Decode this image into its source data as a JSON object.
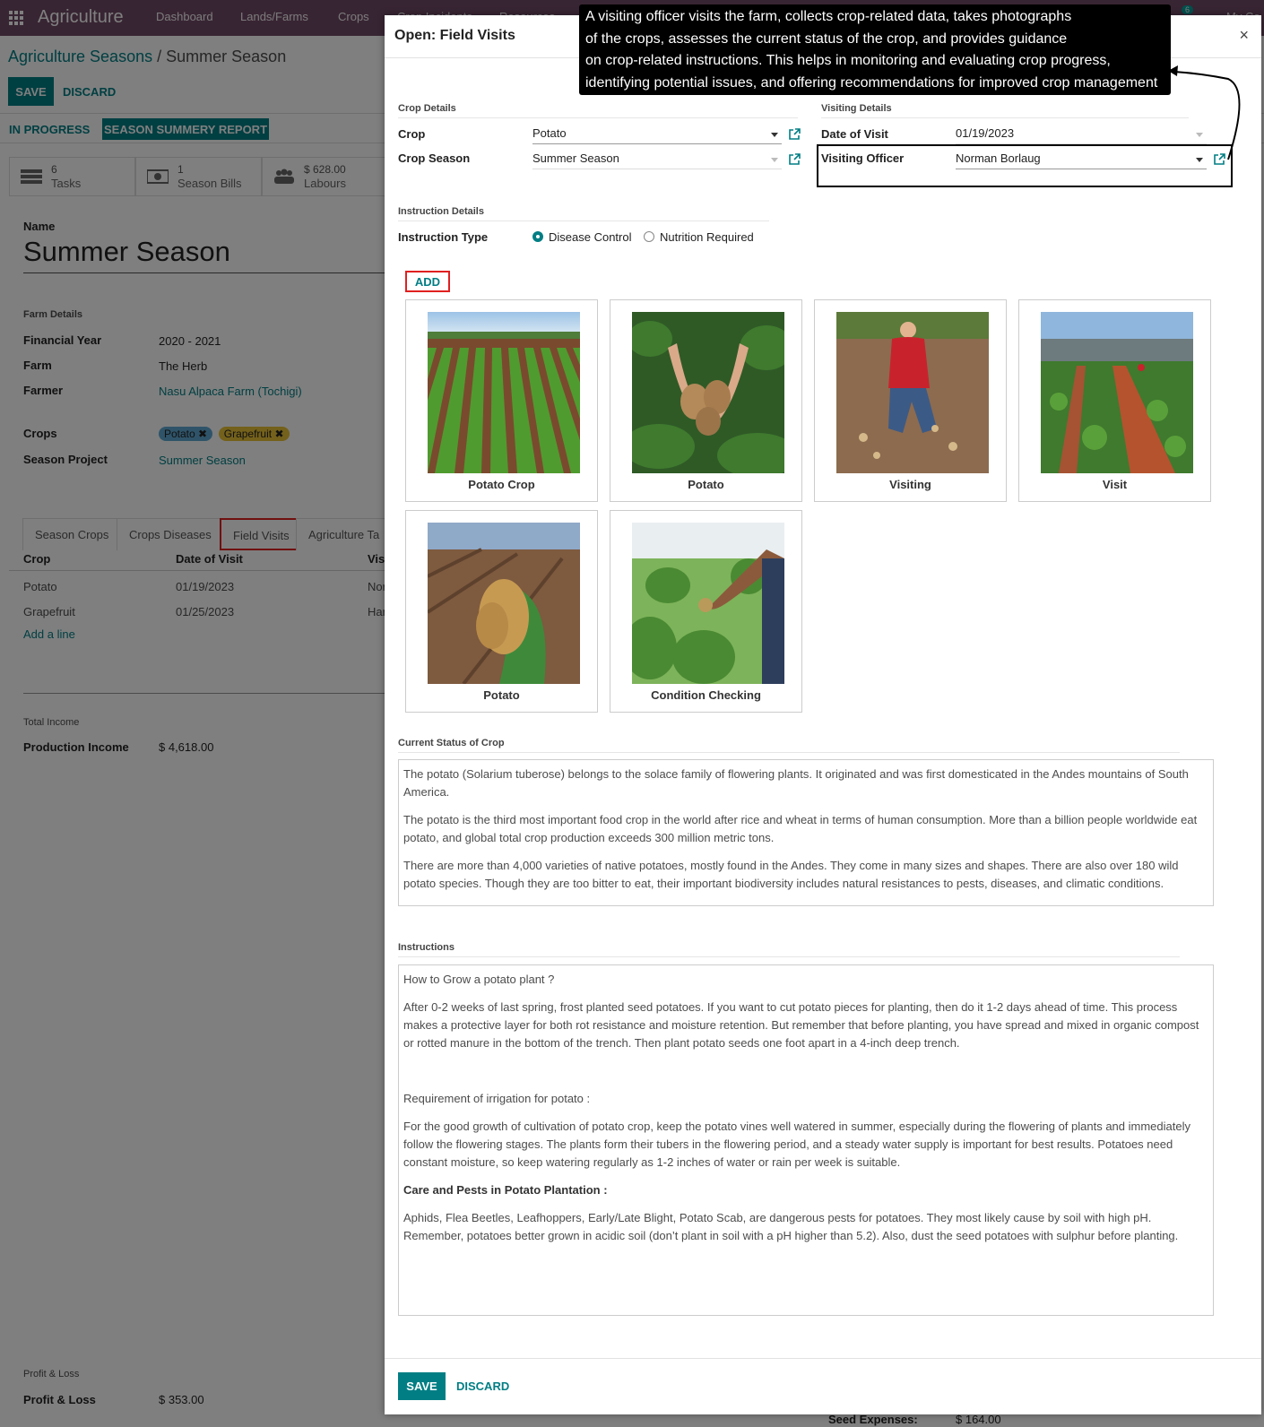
{
  "navbar": {
    "brand": "Agriculture",
    "menus": [
      "Dashboard",
      "Lands/Farms",
      "Crops",
      "Crop Incidents",
      "Resources"
    ],
    "badge": "6",
    "user": "My Co"
  },
  "breadcrumb": {
    "parent": "Agriculture Seasons",
    "separator": "/",
    "current": "Summer Season"
  },
  "form_buttons": {
    "save": "SAVE",
    "discard": "DISCARD"
  },
  "status_buttons": {
    "in_progress": "IN PROGRESS",
    "report": "SEASON SUMMERY REPORT"
  },
  "stats": [
    {
      "num": "6",
      "label": "Tasks",
      "icon": "tasks-icon"
    },
    {
      "num": "1",
      "label": "Season Bills",
      "icon": "bill-icon"
    },
    {
      "num": "$ 628.00",
      "label": "Labours",
      "icon": "users-icon"
    }
  ],
  "season": {
    "name_label": "Name",
    "name": "Summer Season",
    "farm_details_title": "Farm Details",
    "financial_year_label": "Financial Year",
    "financial_year": "2020 - 2021",
    "farm_label": "Farm",
    "farm": "The Herb",
    "farmer_label": "Farmer",
    "farmer": "Nasu Alpaca Farm (Tochigi)",
    "crops_label": "Crops",
    "crops": [
      {
        "name": "Potato",
        "color": "#5fa8d3"
      },
      {
        "name": "Grapefruit",
        "color": "#e8c336"
      }
    ],
    "project_label": "Season Project",
    "project": "Summer Season"
  },
  "season_tabs": [
    "Season Crops",
    "Crops Diseases",
    "Field Visits",
    "Agriculture Ta"
  ],
  "visits_table": {
    "headers": [
      "Crop",
      "Date of Visit",
      "Vis"
    ],
    "rows": [
      [
        "Potato",
        "01/19/2023",
        "Nor"
      ],
      [
        "Grapefruit",
        "01/25/2023",
        "Har"
      ]
    ],
    "add_line": "Add a line"
  },
  "income": {
    "title": "Total Income",
    "label": "Production Income",
    "value": "$ 4,618.00"
  },
  "profit": {
    "title": "Profit & Loss",
    "label": "Profit & Loss",
    "value": "$ 353.00"
  },
  "seed_expenses": {
    "label": "Seed Expenses:",
    "value": "$ 164.00"
  },
  "modal": {
    "title": "Open: Field Visits",
    "close": "×",
    "crop_details_title": "Crop Details",
    "crop_label": "Crop",
    "crop": "Potato",
    "season_label": "Crop Season",
    "season": "Summer Season",
    "visiting_details_title": "Visiting Details",
    "date_label": "Date of Visit",
    "date": "01/19/2023",
    "officer_label": "Visiting Officer",
    "officer": "Norman Borlaug",
    "instruction_details_title": "Instruction Details",
    "instruction_type_label": "Instruction Type",
    "instruction_options": [
      "Disease Control",
      "Nutrition Required"
    ],
    "instruction_selected": "Disease Control",
    "add_button": "ADD",
    "images": [
      "Potato Crop",
      "Potato",
      "Visiting",
      "Visit",
      "Potato",
      "Condition Checking"
    ],
    "status_title": "Current Status of Crop",
    "status_paragraphs": [
      "The potato (Solarium tuberose) belongs to the solace family of flowering plants. It originated and was first domesticated in the Andes mountains of South America.",
      "The potato is the third most important food crop in the world after rice and wheat in terms of human consumption. More than a billion people worldwide eat potato, and global total crop production exceeds 300 million metric tons.",
      "There are more than 4,000 varieties of native potatoes, mostly found in the Andes. They come in many sizes and shapes. There are also over 180 wild potato species. Though they are too bitter to eat, their important biodiversity includes natural resistances to pests, diseases, and climatic conditions."
    ],
    "instructions_title": "Instructions",
    "instructions": {
      "p1": "How to Grow a potato plant ?",
      "p2": "After 0-2 weeks of last spring, frost planted seed potatoes. If you want to cut potato pieces for planting, then do it 1-2 days ahead of time. This process makes a protective layer for both rot resistance and moisture retention. But remember that before planting, you have spread and mixed in organic compost or rotted manure in the bottom of the trench. Then plant potato seeds one foot apart in a 4-inch deep trench.",
      "p3": "Requirement of irrigation for potato :",
      "p4": "For the good growth of cultivation of potato crop, keep the potato vines well watered in summer, especially during the flowering of plants and immediately follow the flowering stages. The plants form their tubers in the flowering period, and a steady water supply is important for best results. Potatoes need constant moisture, so keep watering regularly as 1-2 inches of water or rain per week is suitable.",
      "p5": "Care and Pests in Potato Plantation :",
      "p6": "Aphids, Flea Beetles, Leafhoppers, Early/Late Blight, Potato Scab, are dangerous pests for potatoes. They most likely cause by soil with high pH. Remember, potatoes better grown in acidic soil (don’t plant in soil with a pH higher than 5.2). Also, dust the seed potatoes with sulphur before planting."
    },
    "save": "SAVE",
    "discard": "DISCARD"
  },
  "tooltip": {
    "lines": [
      "A visiting officer visits the farm, collects crop-related data, takes photographs",
      "of the crops, assesses the current status of the crop, and provides guidance",
      "on crop-related instructions. This helps in monitoring and evaluating crop progress,",
      "identifying potential issues, and offering recommendations for improved crop management"
    ]
  },
  "colors": {
    "navbar": "#714b67",
    "accent": "#017e84",
    "highlight": "#e02020"
  }
}
